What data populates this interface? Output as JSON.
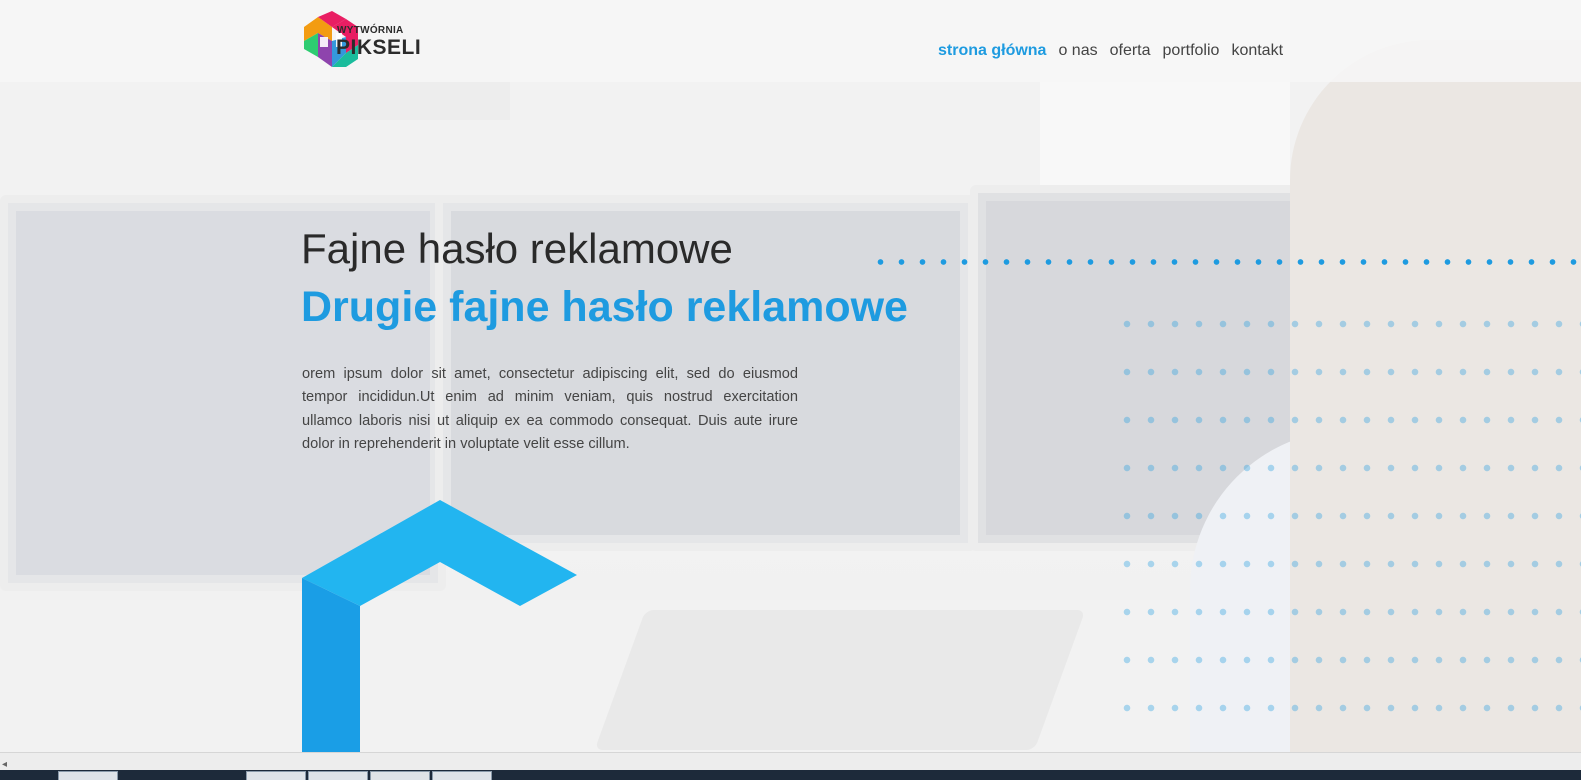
{
  "header": {
    "logo": {
      "line1": "WYTWÓRNIA",
      "line2": "PIKSELI"
    },
    "nav": [
      {
        "label": "strona główna",
        "active": true
      },
      {
        "label": "o nas",
        "active": false
      },
      {
        "label": "oferta",
        "active": false
      },
      {
        "label": "portfolio",
        "active": false
      },
      {
        "label": "kontakt",
        "active": false
      }
    ]
  },
  "hero": {
    "headline_primary": "Fajne hasło reklamowe",
    "headline_secondary": "Drugie fajne hasło reklamowe",
    "body": "orem ipsum dolor sit amet, consectetur adipiscing elit, sed do eiusmod tempor incididun.Ut enim ad minim veniam, quis nostrud exercitation ullamco laboris nisi ut aliquip ex ea commodo consequat. Duis aute irure dolor in reprehenderit in voluptate velit esse cillum."
  },
  "colors": {
    "accent": "#1e9be0",
    "accent_light": "#22b5f0",
    "text_dark": "#2a2a2a"
  },
  "icons": {
    "logo": "cube-logo-icon",
    "scroll_left": "scroll-left-arrow-icon"
  },
  "statusbar": {
    "arrow": "◂"
  }
}
